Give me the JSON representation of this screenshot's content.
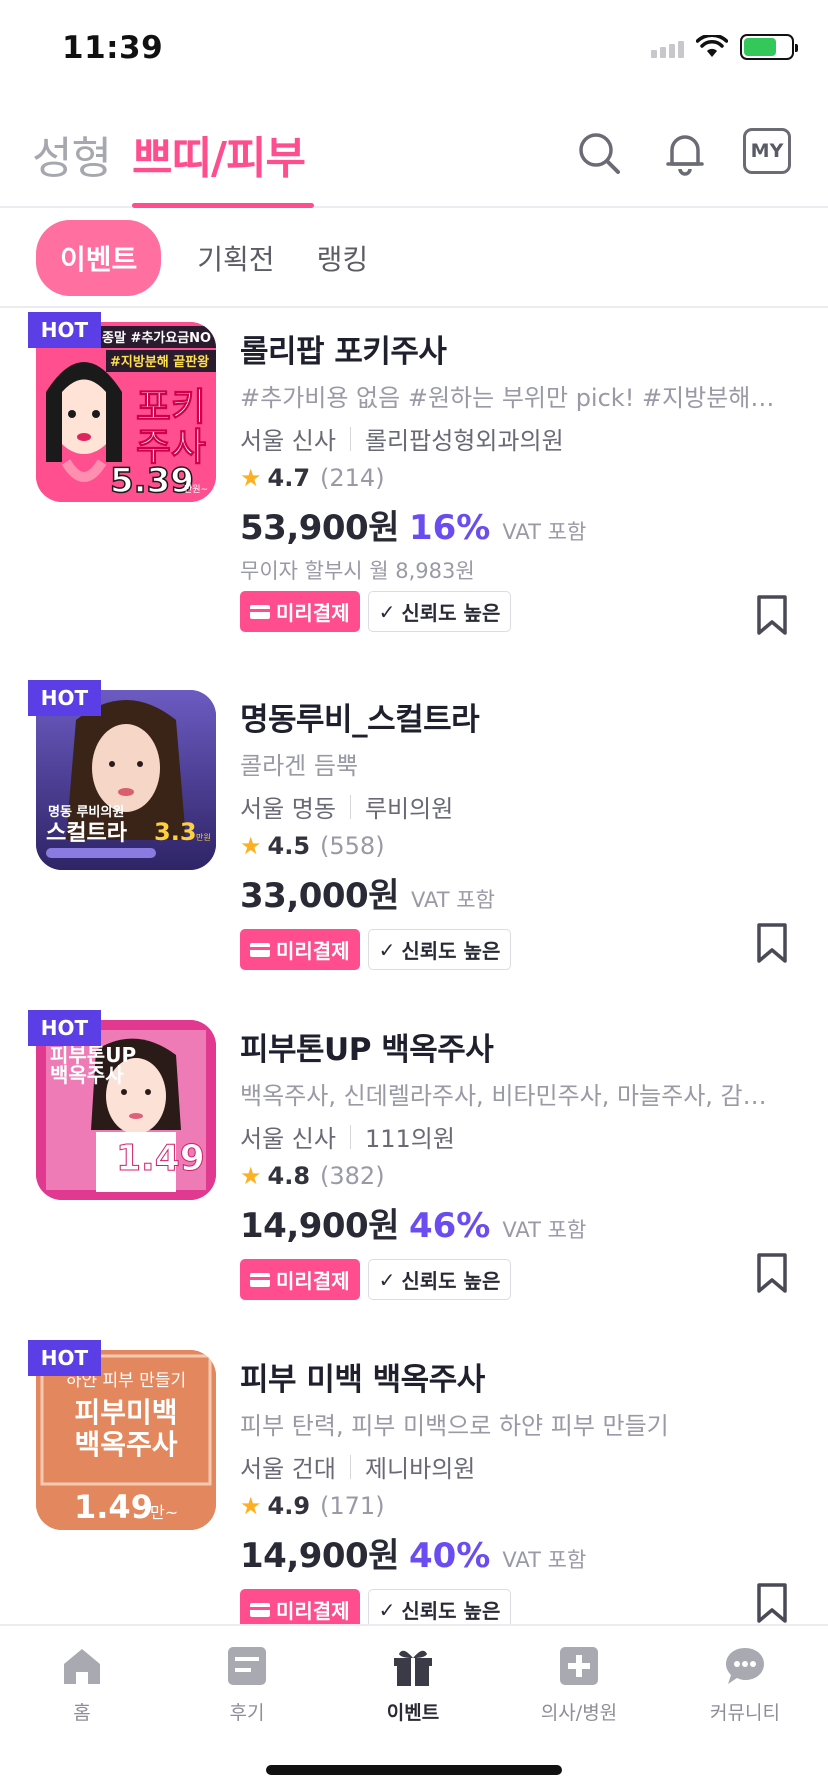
{
  "status": {
    "time": "11:39"
  },
  "header": {
    "tab_inactive": "성형",
    "tab_active": "쁘띠/피부",
    "my_label": "MY"
  },
  "subtabs": [
    "이벤트",
    "기획전",
    "랭킹"
  ],
  "colors": {
    "accent_pink": "#ff4d8d",
    "accent_purple": "#6a4cf0",
    "hot_badge": "#5b3ee6"
  },
  "items": [
    {
      "hot": "HOT",
      "title": "롤리팝 포키주사",
      "tags": "#추가비용 없음 #원하는 부위만 pick! #지방분해주사",
      "region": "서울 신사",
      "clinic": "롤리팝성형외과의원",
      "rating": "4.7",
      "reviews": "(214)",
      "price": "53,900원",
      "discount": "16%",
      "vat": "VAT 포함",
      "installment": "무이자 할부시 월 8,983원",
      "badge_prepay": "미리결제",
      "badge_trust": "신뢰도 높은",
      "thumb": {
        "top_text": "종말 #추가요금NO",
        "sub_text": "#지방분해 끝판왕",
        "main_text_1": "포키",
        "main_text_2": "주사",
        "price_text": "5.39",
        "unit": "만원~"
      }
    },
    {
      "hot": "HOT",
      "title": "명동루비_스컬트라",
      "tags": "콜라겐 듬뿍",
      "region": "서울 명동",
      "clinic": "루비의원",
      "rating": "4.5",
      "reviews": "(558)",
      "price": "33,000원",
      "discount": "",
      "vat": "VAT 포함",
      "badge_prepay": "미리결제",
      "badge_trust": "신뢰도 높은",
      "thumb": {
        "line1": "명동 루비의원",
        "line2": "스컬트라",
        "price_text": "3.3",
        "unit": "만원"
      }
    },
    {
      "hot": "HOT",
      "title": "피부톤UP 백옥주사",
      "tags": "백옥주사, 신데렐라주사, 비타민주사, 마늘주사, 감…",
      "region": "서울 신사",
      "clinic": "111의원",
      "rating": "4.8",
      "reviews": "(382)",
      "price": "14,900원",
      "discount": "46%",
      "vat": "VAT 포함",
      "badge_prepay": "미리결제",
      "badge_trust": "신뢰도 높은",
      "thumb": {
        "line1": "피부톤UP",
        "line2": "백옥주사",
        "price_text": "1.49"
      }
    },
    {
      "hot": "HOT",
      "title": "피부 미백 백옥주사",
      "tags": "피부 탄력, 피부 미백으로 하얀 피부 만들기",
      "region": "서울 건대",
      "clinic": "제니바의원",
      "rating": "4.9",
      "reviews": "(171)",
      "price": "14,900원",
      "discount": "40%",
      "vat": "VAT 포함",
      "badge_prepay": "미리결제",
      "badge_trust": "신뢰도 높은",
      "thumb": {
        "line0": "하얀 피부 만들기",
        "line1": "피부미백",
        "line2": "백옥주사",
        "price_text": "1.49",
        "unit": "만~"
      }
    }
  ],
  "tabbar": [
    {
      "label": "홈",
      "icon": "home-icon"
    },
    {
      "label": "후기",
      "icon": "review-icon"
    },
    {
      "label": "이벤트",
      "icon": "gift-icon"
    },
    {
      "label": "의사/병원",
      "icon": "hospital-icon"
    },
    {
      "label": "커뮤니티",
      "icon": "chat-icon"
    }
  ]
}
